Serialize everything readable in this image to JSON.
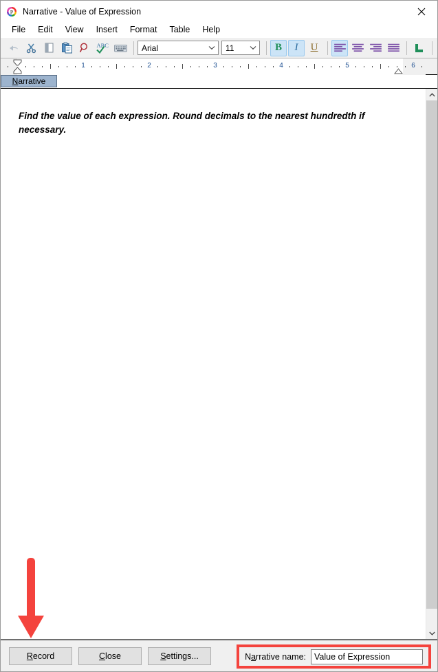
{
  "window": {
    "title": "Narrative - Value of Expression",
    "app_icon": "rainbow-p-icon",
    "close_label": "✕"
  },
  "menu": {
    "items": [
      {
        "label": "File"
      },
      {
        "label": "Edit"
      },
      {
        "label": "View"
      },
      {
        "label": "Insert"
      },
      {
        "label": "Format"
      },
      {
        "label": "Table"
      },
      {
        "label": "Help"
      }
    ]
  },
  "toolbar": {
    "buttons": [
      {
        "name": "undo-icon",
        "title": "Undo",
        "enabled": false
      },
      {
        "name": "cut-icon",
        "title": "Cut",
        "enabled": true
      },
      {
        "name": "copy-icon",
        "title": "Copy",
        "enabled": true
      },
      {
        "name": "paste-icon",
        "title": "Paste",
        "enabled": true
      },
      {
        "name": "find-icon",
        "title": "Find",
        "enabled": true
      },
      {
        "name": "spellcheck-icon",
        "title": "Spelling",
        "enabled": true
      },
      {
        "name": "keyboard-icon",
        "title": "Keyboard",
        "enabled": true
      }
    ],
    "font_name": "Arial",
    "font_size": "11",
    "bold_label": "B",
    "italic_label": "I",
    "underline_label": "U",
    "bold_active": true,
    "italic_active": true,
    "underline_active": false,
    "align_active": "left",
    "align_buttons": [
      "align-left",
      "align-center",
      "align-right",
      "align-justify"
    ],
    "extra_buttons": [
      "tab-stop-icon",
      "help-icon"
    ]
  },
  "ruler": {
    "numbers": [
      "1",
      "2",
      "3",
      "4",
      "5",
      "6"
    ],
    "unit": "inches",
    "left_indent_pos": "0",
    "right_indent_pos": "6"
  },
  "tabs": {
    "items": [
      {
        "label": "Narrative",
        "accesskey": "N",
        "active": true
      }
    ]
  },
  "document": {
    "paragraphs": [
      "Find the value of each expression. Round decimals to the nearest hundredth if necessary."
    ],
    "style": {
      "bold": true,
      "italic": true
    }
  },
  "scrollbar": {
    "up_arrow": "chevron-up-icon",
    "down_arrow": "chevron-down-icon"
  },
  "bottom_bar": {
    "buttons": [
      {
        "label": "Record",
        "accesskey": "R"
      },
      {
        "label": "Close",
        "accesskey": "C"
      },
      {
        "label": "Settings...",
        "accesskey": "S"
      }
    ],
    "narrative_name_label": "Narrative name:",
    "narrative_name_accesskey": "a",
    "narrative_name_value": "Value of Expression",
    "narrative_name_placeholder": "Narrative name"
  },
  "annotations": {
    "arrow_color": "#f4433d",
    "highlight_color": "#f4433d",
    "arrow_points_to": "Record",
    "highlight_around": "Narrative name field"
  }
}
